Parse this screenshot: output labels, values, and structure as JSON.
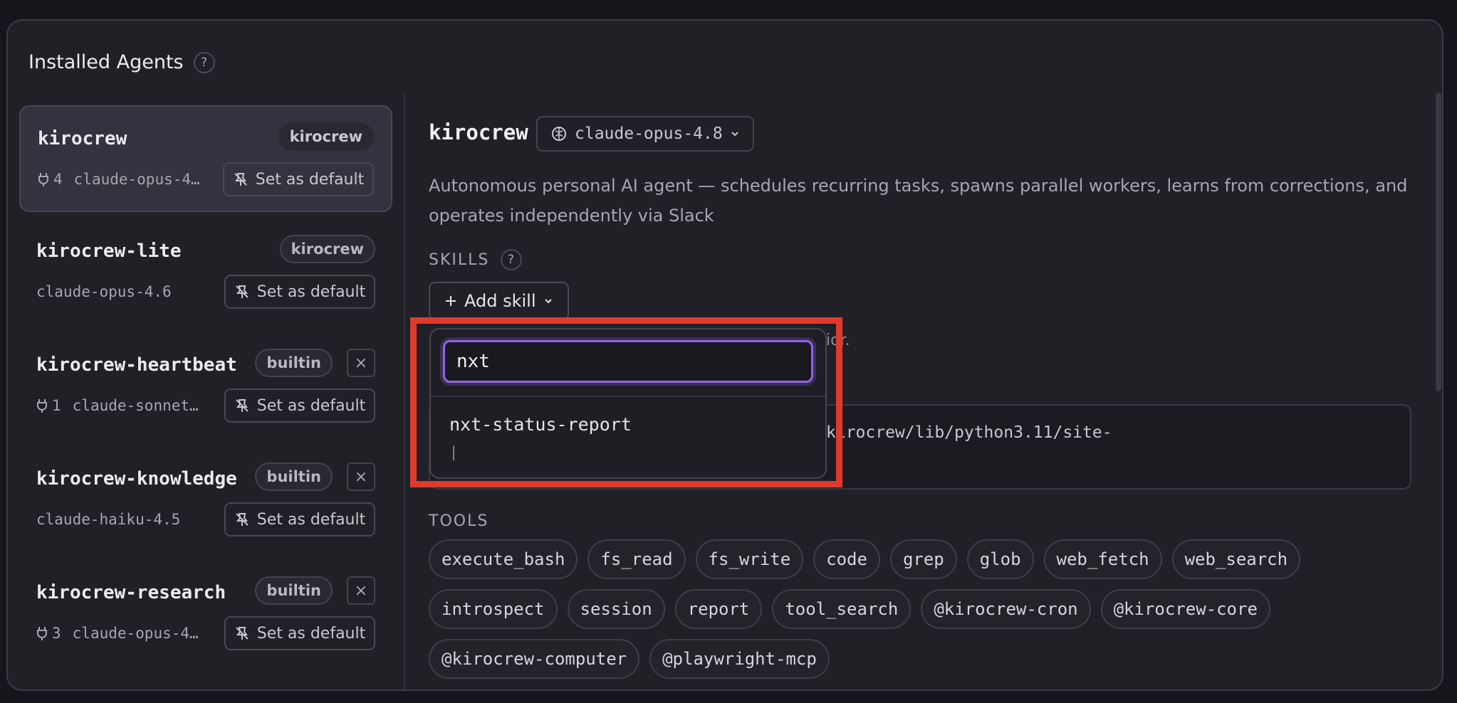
{
  "header": {
    "title": "Installed Agents",
    "help_glyph": "?"
  },
  "agents": [
    {
      "name": "kirocrew",
      "badge": "kirocrew",
      "tool_count": "4",
      "model": "claude-opus-4…",
      "action": "Set as default",
      "removable": false,
      "selected": true
    },
    {
      "name": "kirocrew-lite",
      "badge": "kirocrew",
      "tool_count": "",
      "model": "claude-opus-4.6",
      "action": "Set as default",
      "removable": false,
      "selected": false
    },
    {
      "name": "kirocrew-heartbeat",
      "badge": "builtin",
      "tool_count": "1",
      "model": "claude-sonnet…",
      "action": "Set as default",
      "removable": true,
      "selected": false
    },
    {
      "name": "kirocrew-knowledge",
      "badge": "builtin",
      "tool_count": "",
      "model": "claude-haiku-4.5",
      "action": "Set as default",
      "removable": true,
      "selected": false
    },
    {
      "name": "kirocrew-research",
      "badge": "builtin",
      "tool_count": "3",
      "model": "claude-opus-4…",
      "action": "Set as default",
      "removable": true,
      "selected": false
    }
  ],
  "detail": {
    "name": "kirocrew",
    "model": "claude-opus-4.8",
    "description": "Autonomous personal AI agent — schedules recurring tasks, spawns parallel workers, learns from corrections, and operates independently via Slack",
    "skills_label": "SKILLS",
    "add_skill_label": "Add skill",
    "partial_hint": "ior.",
    "partial_path": "kirocrew/lib/python3.11/site-",
    "tools_label": "TOOLS",
    "tools": [
      [
        "execute_bash",
        "fs_read",
        "fs_write",
        "code",
        "grep",
        "glob",
        "web_fetch",
        "web_search"
      ],
      [
        "introspect",
        "session",
        "report",
        "tool_search",
        "@kirocrew-cron",
        "@kirocrew-core"
      ],
      [
        "@kirocrew-computer",
        "@playwright-mcp"
      ]
    ]
  },
  "skill_dropdown": {
    "query": "nxt",
    "results": [
      "nxt-status-report"
    ],
    "caret": "|"
  },
  "colors": {
    "accent": "#8f63e8",
    "highlight": "#e03a2a"
  }
}
